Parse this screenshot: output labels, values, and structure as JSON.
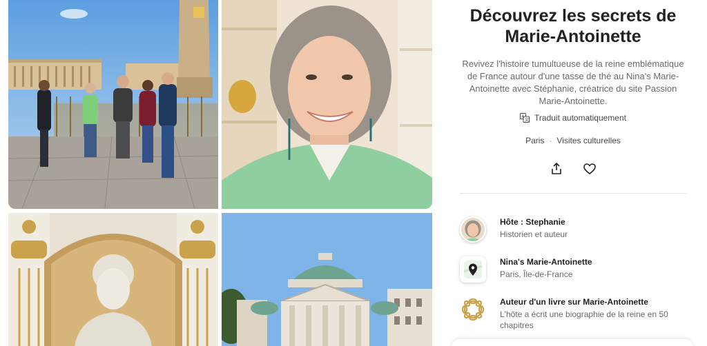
{
  "experience": {
    "title_line1": "Découvrez les secrets de",
    "title_line2": "Marie-Antoinette",
    "description": "Revivez l'histoire tumultueuse de la reine emblématique de France autour d'une tasse de thé au Nina's Marie-Antoinette avec Stéphanie, créatrice du site Passion Marie-Antoinette.",
    "translated_label": "Traduit automatiquement",
    "location": "Paris",
    "separator": "·",
    "category": "Visites culturelles"
  },
  "gallery": {
    "photos": [
      {
        "icon": "tour-group-photo"
      },
      {
        "icon": "host-portrait-photo"
      },
      {
        "icon": "marie-antoinette-bust-photo"
      },
      {
        "icon": "chapelle-expiatoire-photo"
      }
    ]
  },
  "highlights": [
    {
      "title": "Hôte : Stephanie",
      "subtitle": "Historien et auteur",
      "icon": "host-avatar"
    },
    {
      "title": "Nina's Marie-Antoinette",
      "subtitle": "Paris, Île-de-France",
      "icon": "map-pin-icon"
    },
    {
      "title": "Auteur d'un livre sur Marie-Antoinette",
      "subtitle": "L'hôte a écrit une biographie de la reine en 50 chapitres",
      "icon": "laurel-badge-icon"
    }
  ],
  "colors": {
    "text": "#222222",
    "muted": "#6a6a6a",
    "cardigan_green": "#8fcf9f",
    "gold": "#c9a24b"
  }
}
